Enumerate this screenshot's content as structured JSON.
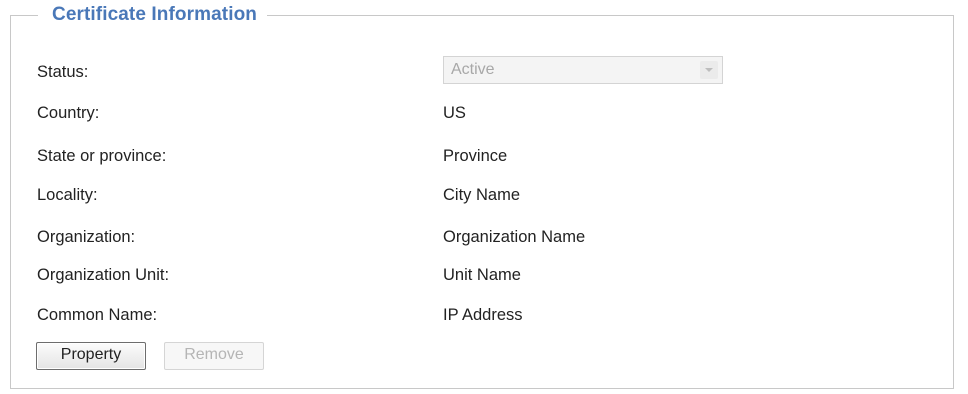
{
  "section": {
    "title": "Certificate Information"
  },
  "fields": {
    "status": {
      "label": "Status:",
      "value": "Active"
    },
    "country": {
      "label": "Country:",
      "value": "US"
    },
    "state": {
      "label": "State or province:",
      "value": "Province"
    },
    "locality": {
      "label": "Locality:",
      "value": "City Name"
    },
    "organization": {
      "label": "Organization:",
      "value": "Organization Name"
    },
    "org_unit": {
      "label": "Organization Unit:",
      "value": "Unit Name"
    },
    "common_name": {
      "label": "Common Name:",
      "value": "IP Address"
    }
  },
  "buttons": {
    "property": "Property",
    "remove": "Remove"
  },
  "icons": {
    "dropdown": "chevron-down-icon"
  },
  "colors": {
    "title": "#4a78b8",
    "border": "#c8c8c8",
    "disabled_text": "#b5b5b5"
  }
}
